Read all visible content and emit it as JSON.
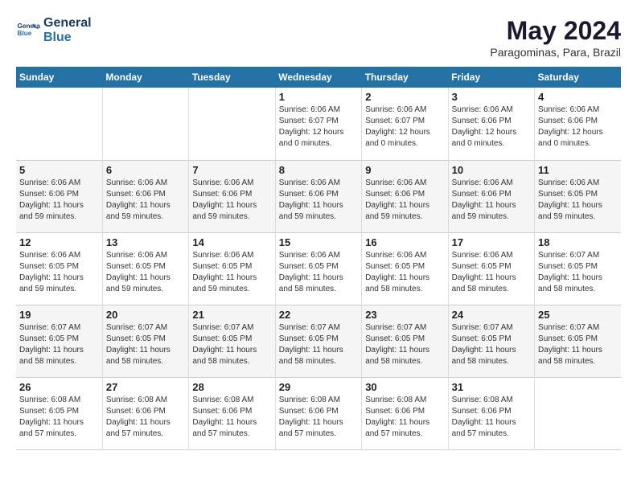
{
  "logo": {
    "line1": "General",
    "line2": "Blue"
  },
  "header": {
    "month": "May 2024",
    "location": "Paragominas, Para, Brazil"
  },
  "weekdays": [
    "Sunday",
    "Monday",
    "Tuesday",
    "Wednesday",
    "Thursday",
    "Friday",
    "Saturday"
  ],
  "weeks": [
    [
      {
        "day": "",
        "info": ""
      },
      {
        "day": "",
        "info": ""
      },
      {
        "day": "",
        "info": ""
      },
      {
        "day": "1",
        "info": "Sunrise: 6:06 AM\nSunset: 6:07 PM\nDaylight: 12 hours\nand 0 minutes."
      },
      {
        "day": "2",
        "info": "Sunrise: 6:06 AM\nSunset: 6:07 PM\nDaylight: 12 hours\nand 0 minutes."
      },
      {
        "day": "3",
        "info": "Sunrise: 6:06 AM\nSunset: 6:06 PM\nDaylight: 12 hours\nand 0 minutes."
      },
      {
        "day": "4",
        "info": "Sunrise: 6:06 AM\nSunset: 6:06 PM\nDaylight: 12 hours\nand 0 minutes."
      }
    ],
    [
      {
        "day": "5",
        "info": "Sunrise: 6:06 AM\nSunset: 6:06 PM\nDaylight: 11 hours\nand 59 minutes."
      },
      {
        "day": "6",
        "info": "Sunrise: 6:06 AM\nSunset: 6:06 PM\nDaylight: 11 hours\nand 59 minutes."
      },
      {
        "day": "7",
        "info": "Sunrise: 6:06 AM\nSunset: 6:06 PM\nDaylight: 11 hours\nand 59 minutes."
      },
      {
        "day": "8",
        "info": "Sunrise: 6:06 AM\nSunset: 6:06 PM\nDaylight: 11 hours\nand 59 minutes."
      },
      {
        "day": "9",
        "info": "Sunrise: 6:06 AM\nSunset: 6:06 PM\nDaylight: 11 hours\nand 59 minutes."
      },
      {
        "day": "10",
        "info": "Sunrise: 6:06 AM\nSunset: 6:06 PM\nDaylight: 11 hours\nand 59 minutes."
      },
      {
        "day": "11",
        "info": "Sunrise: 6:06 AM\nSunset: 6:05 PM\nDaylight: 11 hours\nand 59 minutes."
      }
    ],
    [
      {
        "day": "12",
        "info": "Sunrise: 6:06 AM\nSunset: 6:05 PM\nDaylight: 11 hours\nand 59 minutes."
      },
      {
        "day": "13",
        "info": "Sunrise: 6:06 AM\nSunset: 6:05 PM\nDaylight: 11 hours\nand 59 minutes."
      },
      {
        "day": "14",
        "info": "Sunrise: 6:06 AM\nSunset: 6:05 PM\nDaylight: 11 hours\nand 59 minutes."
      },
      {
        "day": "15",
        "info": "Sunrise: 6:06 AM\nSunset: 6:05 PM\nDaylight: 11 hours\nand 58 minutes."
      },
      {
        "day": "16",
        "info": "Sunrise: 6:06 AM\nSunset: 6:05 PM\nDaylight: 11 hours\nand 58 minutes."
      },
      {
        "day": "17",
        "info": "Sunrise: 6:06 AM\nSunset: 6:05 PM\nDaylight: 11 hours\nand 58 minutes."
      },
      {
        "day": "18",
        "info": "Sunrise: 6:07 AM\nSunset: 6:05 PM\nDaylight: 11 hours\nand 58 minutes."
      }
    ],
    [
      {
        "day": "19",
        "info": "Sunrise: 6:07 AM\nSunset: 6:05 PM\nDaylight: 11 hours\nand 58 minutes."
      },
      {
        "day": "20",
        "info": "Sunrise: 6:07 AM\nSunset: 6:05 PM\nDaylight: 11 hours\nand 58 minutes."
      },
      {
        "day": "21",
        "info": "Sunrise: 6:07 AM\nSunset: 6:05 PM\nDaylight: 11 hours\nand 58 minutes."
      },
      {
        "day": "22",
        "info": "Sunrise: 6:07 AM\nSunset: 6:05 PM\nDaylight: 11 hours\nand 58 minutes."
      },
      {
        "day": "23",
        "info": "Sunrise: 6:07 AM\nSunset: 6:05 PM\nDaylight: 11 hours\nand 58 minutes."
      },
      {
        "day": "24",
        "info": "Sunrise: 6:07 AM\nSunset: 6:05 PM\nDaylight: 11 hours\nand 58 minutes."
      },
      {
        "day": "25",
        "info": "Sunrise: 6:07 AM\nSunset: 6:05 PM\nDaylight: 11 hours\nand 58 minutes."
      }
    ],
    [
      {
        "day": "26",
        "info": "Sunrise: 6:08 AM\nSunset: 6:05 PM\nDaylight: 11 hours\nand 57 minutes."
      },
      {
        "day": "27",
        "info": "Sunrise: 6:08 AM\nSunset: 6:06 PM\nDaylight: 11 hours\nand 57 minutes."
      },
      {
        "day": "28",
        "info": "Sunrise: 6:08 AM\nSunset: 6:06 PM\nDaylight: 11 hours\nand 57 minutes."
      },
      {
        "day": "29",
        "info": "Sunrise: 6:08 AM\nSunset: 6:06 PM\nDaylight: 11 hours\nand 57 minutes."
      },
      {
        "day": "30",
        "info": "Sunrise: 6:08 AM\nSunset: 6:06 PM\nDaylight: 11 hours\nand 57 minutes."
      },
      {
        "day": "31",
        "info": "Sunrise: 6:08 AM\nSunset: 6:06 PM\nDaylight: 11 hours\nand 57 minutes."
      },
      {
        "day": "",
        "info": ""
      }
    ]
  ]
}
